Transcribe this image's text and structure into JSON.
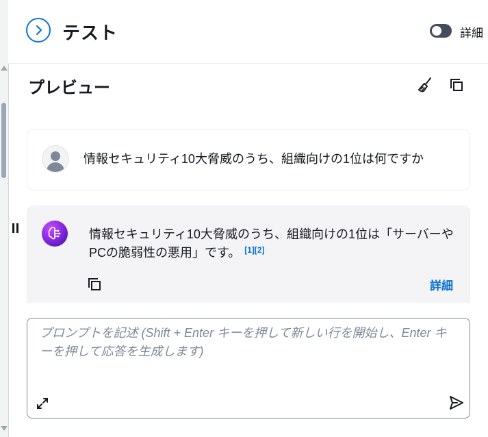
{
  "header": {
    "title": "テスト",
    "toggle_label": "詳細",
    "toggle_on": false
  },
  "preview": {
    "title": "プレビュー"
  },
  "messages": {
    "user": {
      "text": "情報セキュリティ10大脅威のうち、組織向けの1位は何ですか"
    },
    "bot": {
      "text": "情報セキュリティ10大脅威のうち、組織向けの1位は「サーバーや PCの脆弱性の悪用」です。",
      "citations": "[1][2]",
      "details_label": "詳細"
    }
  },
  "prompt": {
    "placeholder": "プロンプトを記述 (Shift + Enter キーを押して新しい行を開始し、Enter キーを押して応答を生成します)"
  },
  "colors": {
    "accent": "#0972d3",
    "text": "#16191f",
    "muted": "#7d8998",
    "bot_bg": "#f4f4f6"
  },
  "icons": {
    "collapse": "chevron-right-icon",
    "clear": "broom-icon",
    "copy": "copy-icon",
    "expand": "expand-icon",
    "send": "send-icon"
  }
}
